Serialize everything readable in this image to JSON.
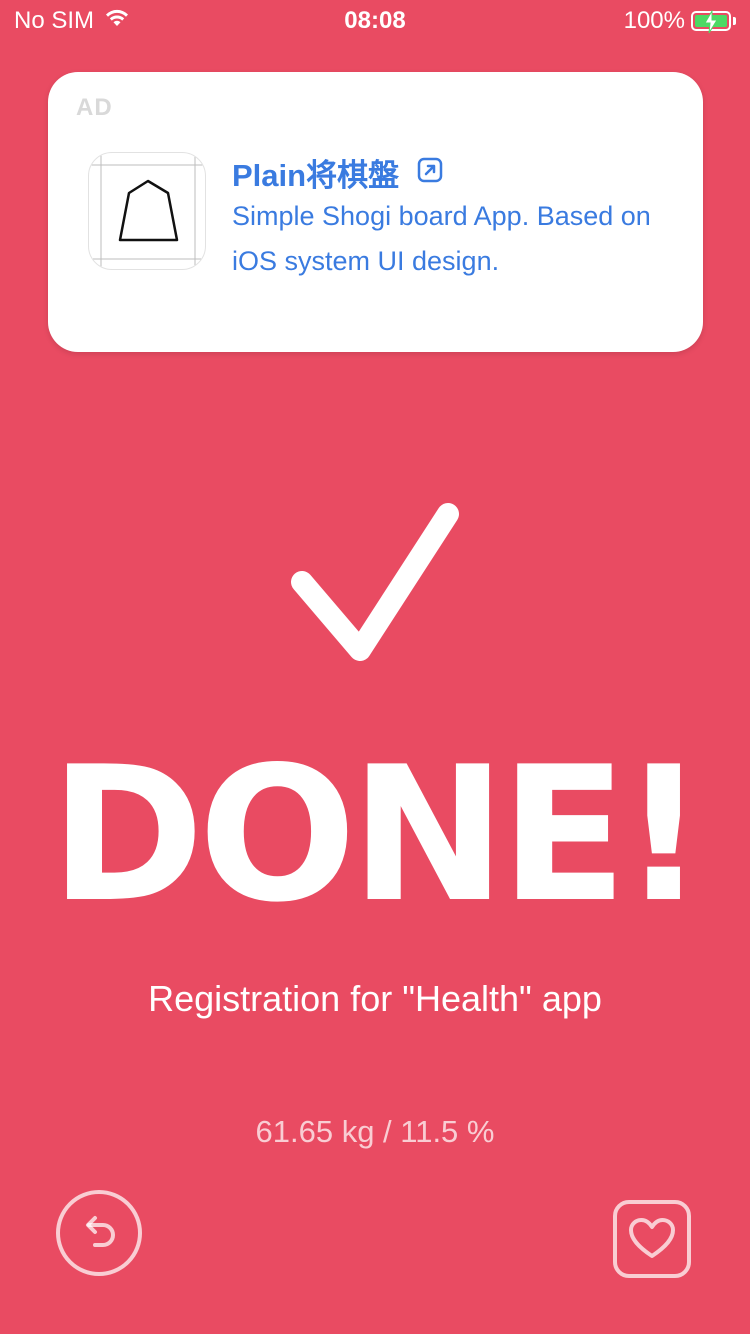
{
  "status_bar": {
    "carrier": "No SIM",
    "time": "08:08",
    "battery": "100%",
    "battery_level": 1.0
  },
  "ad": {
    "label": "AD",
    "title": "Plain将棋盤",
    "description": "Simple Shogi board App. Based on iOS system UI design.",
    "icon": "shogi-piece-icon",
    "external_link_icon": "external-link-icon"
  },
  "main": {
    "check_icon": "checkmark-icon",
    "headline": "DONE!",
    "subtitle": "Registration for \"Health\" app",
    "values": "61.65 kg / 11.5 %"
  },
  "bottom": {
    "back_icon": "undo-arrow-icon",
    "health_icon": "heart-icon"
  },
  "colors": {
    "background": "#E94B62",
    "ad_text": "#3A7BE0",
    "battery_fill": "#4CD964"
  }
}
